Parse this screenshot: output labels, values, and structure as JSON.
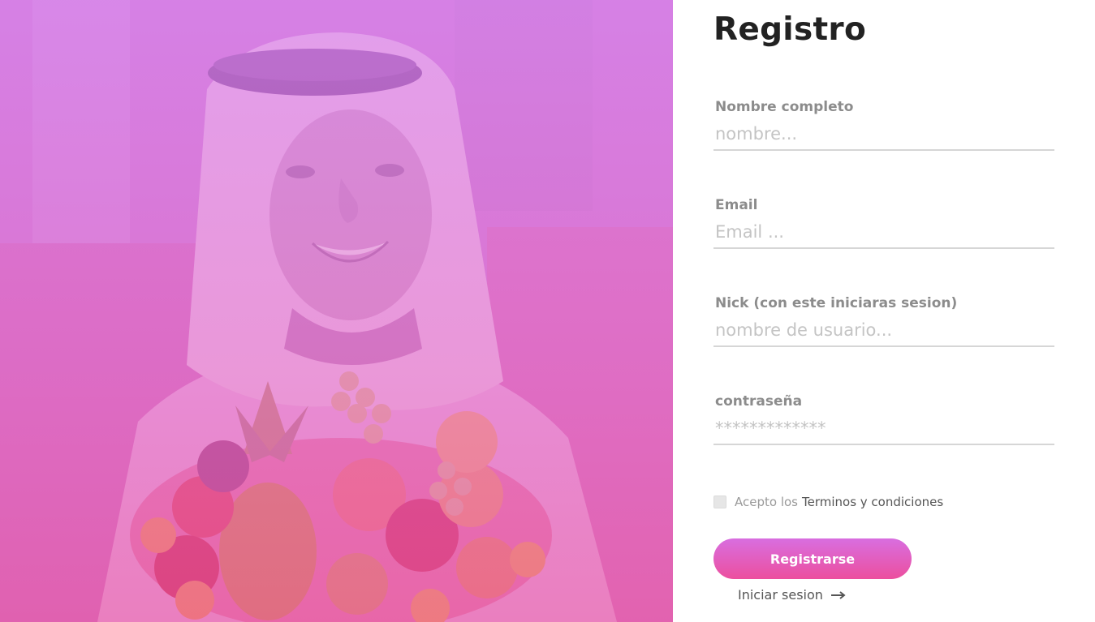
{
  "form": {
    "title": "Registro",
    "fields": [
      {
        "label": "Nombre completo",
        "placeholder": "nombre...",
        "type": "text"
      },
      {
        "label": "Email",
        "placeholder": "Email ...",
        "type": "email"
      },
      {
        "label": "Nick (con este iniciaras sesion)",
        "placeholder": "nombre de usuario...",
        "type": "text"
      },
      {
        "label": "contraseña",
        "placeholder": "*************",
        "type": "password"
      }
    ],
    "terms": {
      "prefix": "Acepto los",
      "link": "Terminos y condiciones",
      "checked": false
    },
    "submit_label": "Registrarse",
    "login_label": "Iniciar sesion",
    "login_icon": "arrow-right-icon"
  },
  "hero": {
    "image": "man-in-white-keffiyeh-holding-fruit-basket",
    "overlay_colors": [
      "#d88ee8",
      "#e55faa"
    ]
  },
  "colors": {
    "accent_top": "#d86ee0",
    "accent_bottom": "#ec4f9e",
    "title": "#222222",
    "label": "#8c8c8c"
  }
}
